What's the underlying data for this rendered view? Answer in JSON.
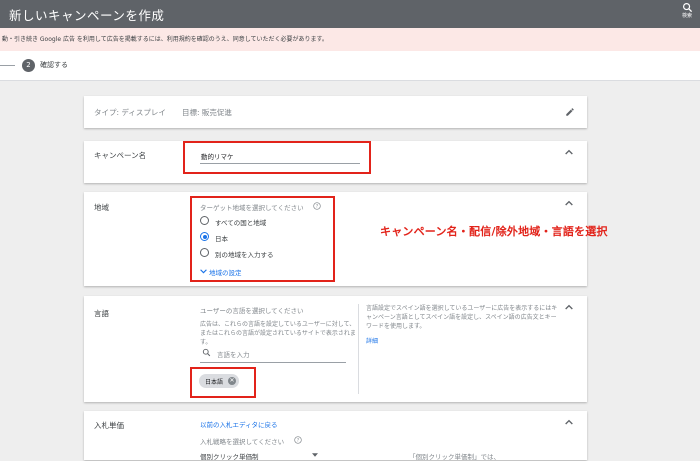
{
  "header": {
    "title": "新しいキャンペーンを作成",
    "help_label": "検索"
  },
  "notice": {
    "text": "動・引き続き Google 広告 を利用して広告を掲載するには、利用規約を確認のうえ、同意していただく必要があります。"
  },
  "stepper": {
    "step_number": "2",
    "step_label": "確認する"
  },
  "type_card": {
    "type_text": "タイプ: ディスプレイ",
    "goal_text": "目標: 販売促進"
  },
  "campaign_name": {
    "label": "キャンペーン名",
    "value": "動的リマケ"
  },
  "location": {
    "label": "地域",
    "prompt": "ターゲット地域を選択してください",
    "options": [
      "すべての国と地域",
      "日本",
      "別の地域を入力する"
    ],
    "selected": "日本",
    "settings_link": "地域の設定"
  },
  "language": {
    "label": "言語",
    "prompt": "ユーザーの言語を選択してください",
    "description": "広告は、これらの言語を設定しているユーザーに対して、またはこれらの言語が設定されているサイトで表示されます。",
    "search_placeholder": "言語を入力",
    "chip": "日本語",
    "help_text": "言語設定でスペイン語を選択しているユーザーに広告を表示するにはキャンペーン言語としてスペイン語を設定し、スペイン語の広告文とキーワードを使用します。",
    "detail_link": "詳細"
  },
  "bidding": {
    "label": "入札単価",
    "editor_link": "以前の入札エディタに戻る",
    "prompt": "入札戦略を選択してください",
    "strategy": "個別クリック単価制",
    "side_text": "「個別クリック単価制」では、"
  },
  "annotation": "キャンペーン名・配信/除外地域・言語を選択"
}
